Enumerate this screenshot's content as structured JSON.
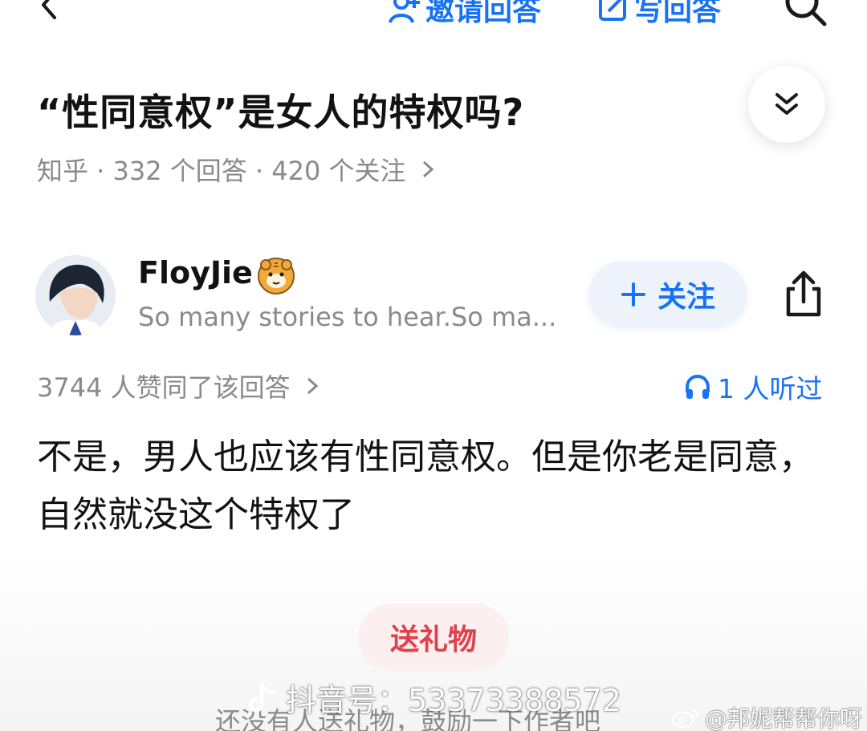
{
  "top_bar": {
    "invite_label": "邀请回答",
    "write_label": "写回答"
  },
  "question": {
    "title": "“性同意权”是女人的特权吗?",
    "meta": "知乎 · 332 个回答 · 420 个关注"
  },
  "author": {
    "name": "FloyJie",
    "bio": "So many stories to hear.So ma...",
    "follow_label": "关注"
  },
  "stats": {
    "likes": "3744 人赞同了该回答",
    "listened": "1 人听过"
  },
  "answer": {
    "text": "不是，男人也应该有性同意权。但是你老是同意，自然就没这个特权了"
  },
  "gift": {
    "button_label": "送礼物",
    "hint": "还没有人送礼物，鼓励一下作者吧"
  },
  "watermarks": {
    "douyin": "抖音号：53373388572",
    "weibo": "@邦妮帮帮你呀"
  },
  "colors": {
    "accent": "#1772f6",
    "gift": "#e0414a",
    "secondary_text": "#8a8a8a"
  }
}
